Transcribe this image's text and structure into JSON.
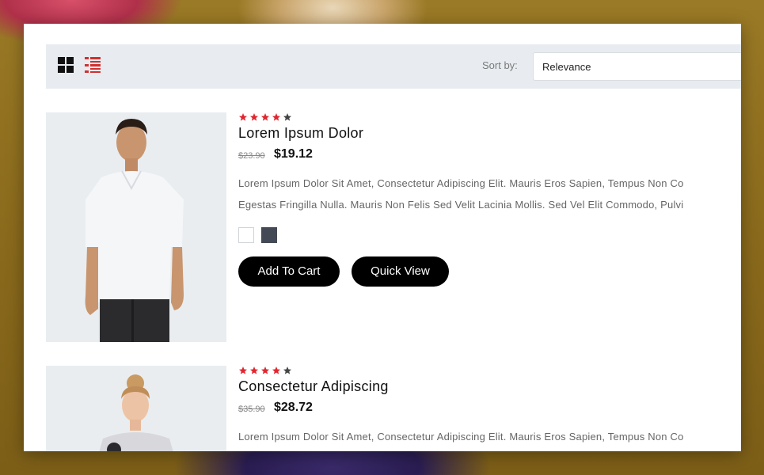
{
  "toolbar": {
    "sort_label": "Sort by:",
    "sort_value": "Relevance"
  },
  "colors": {
    "star_filled": "#e0262f",
    "star_empty": "#444444",
    "button_bg": "#000000",
    "toolbar_bg": "#e8ecf0",
    "list_icon": "#d32f2f"
  },
  "products": [
    {
      "rating": 4,
      "rating_max": 5,
      "title": "Lorem Ipsum Dolor",
      "old_price": "$23.90",
      "price": "$19.12",
      "desc_line1": "Lorem Ipsum Dolor Sit Amet, Consectetur Adipiscing Elit. Mauris Eros Sapien, Tempus Non Co",
      "desc_line2": "Egestas Fringilla Nulla. Mauris Non Felis Sed Velit Lacinia Mollis. Sed Vel Elit Commodo, Pulvi",
      "swatches": [
        "white",
        "dark-slate"
      ],
      "add_to_cart": "Add To Cart",
      "quick_view": "Quick View"
    },
    {
      "rating": 4,
      "rating_max": 5,
      "title": "Consectetur Adipiscing",
      "old_price": "$35.90",
      "price": "$28.72",
      "desc_line1": "Lorem Ipsum Dolor Sit Amet, Consectetur Adipiscing Elit. Mauris Eros Sapien, Tempus Non Co"
    }
  ]
}
